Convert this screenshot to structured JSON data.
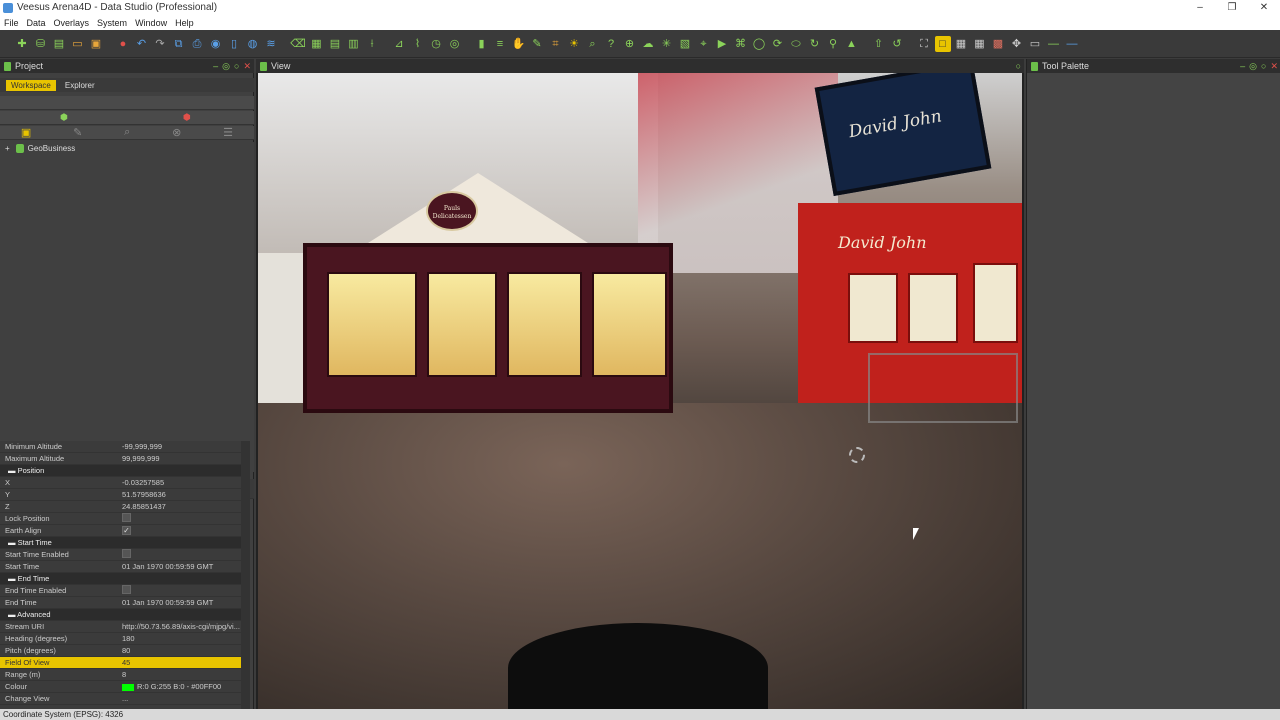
{
  "window": {
    "title": "Veesus Arena4D - Data Studio (Professional)",
    "controls": [
      "–",
      "❐",
      "✕"
    ]
  },
  "menu": [
    "File",
    "Data",
    "Overlays",
    "System",
    "Window",
    "Help"
  ],
  "toolbar": {
    "icons": [
      "new-icon",
      "database-icon",
      "save-icon",
      "open-icon",
      "export-icon",
      "stop-icon",
      "undo-icon",
      "redo-icon",
      "copy-icon",
      "print-icon",
      "camera-icon",
      "document-icon",
      "globe-icon",
      "layers-icon",
      "eraser-icon",
      "grid-icon",
      "sheet-icon",
      "table-icon",
      "measure-icon",
      "ruler-icon",
      "chart-icon",
      "clock-icon",
      "record-icon",
      "bar-chart-icon",
      "stack-icon",
      "hand-icon",
      "pencil-icon",
      "crop-icon",
      "sun-icon",
      "search-icon",
      "help-icon",
      "target-icon",
      "cloud-icon",
      "spark-icon",
      "select-icon",
      "pin-icon",
      "video-icon",
      "mesh-icon",
      "circle-icon",
      "rotate-icon",
      "cylinder-icon",
      "refresh-icon",
      "walk-icon",
      "up-arrow-icon",
      "up-arrow-alt-icon",
      "reload-icon",
      "fit-icon",
      "single-view-icon",
      "grid-2-icon",
      "grid-3-icon",
      "grid-4-icon",
      "pan-icon",
      "window-icon",
      "line-icon",
      "line-alt-icon"
    ],
    "active_index": 47
  },
  "project_panel": {
    "title": "Project",
    "tabs": [
      "Workspace",
      "Explorer"
    ],
    "active_tab": 0,
    "tree": [
      {
        "label": "GeoBusiness",
        "expand": "+"
      }
    ]
  },
  "properties": [
    {
      "k": "Minimum Altitude",
      "v": "-99,999,999"
    },
    {
      "k": "Maximum Altitude",
      "v": "99,999,999"
    },
    {
      "k": "Position",
      "section": true
    },
    {
      "k": "X",
      "v": "-0.03257585"
    },
    {
      "k": "Y",
      "v": "51.57958636"
    },
    {
      "k": "Z",
      "v": "24.85851437"
    },
    {
      "k": "Lock Position",
      "check": false
    },
    {
      "k": "Earth Align",
      "check": true
    },
    {
      "k": "Start Time",
      "section": true
    },
    {
      "k": "Start Time Enabled",
      "check": false
    },
    {
      "k": "Start Time",
      "v": "01 Jan 1970 00:59:59 GMT"
    },
    {
      "k": "End Time",
      "section": true
    },
    {
      "k": "End Time Enabled",
      "check": false
    },
    {
      "k": "End Time",
      "v": "01 Jan 1970 00:59:59 GMT"
    },
    {
      "k": "Advanced",
      "section": true
    },
    {
      "k": "Stream URI",
      "v": "http://50.73.56.89/axis-cgi/mjpg/vi..."
    },
    {
      "k": "Heading (degrees)",
      "v": "180"
    },
    {
      "k": "Pitch (degrees)",
      "v": "80"
    },
    {
      "k": "Field Of View",
      "v": "45",
      "highlight": true
    },
    {
      "k": "Range (m)",
      "v": "8"
    },
    {
      "k": "Colour",
      "v": "R:0 G:255 B:0 - #00FF00",
      "color": "#00FF00"
    },
    {
      "k": "Change View",
      "v": "..."
    }
  ],
  "view_panel": {
    "title": "View"
  },
  "scene": {
    "sign_left": "Pauls Delicatessen",
    "sign_red": "David John",
    "board": "David John"
  },
  "palette_panel": {
    "title": "Tool Palette"
  },
  "status": {
    "text": "Coordinate System (EPSG): 4326"
  },
  "colors": {
    "accent": "#e8c400",
    "panel": "#404040",
    "status_green": "#6cc04a"
  }
}
